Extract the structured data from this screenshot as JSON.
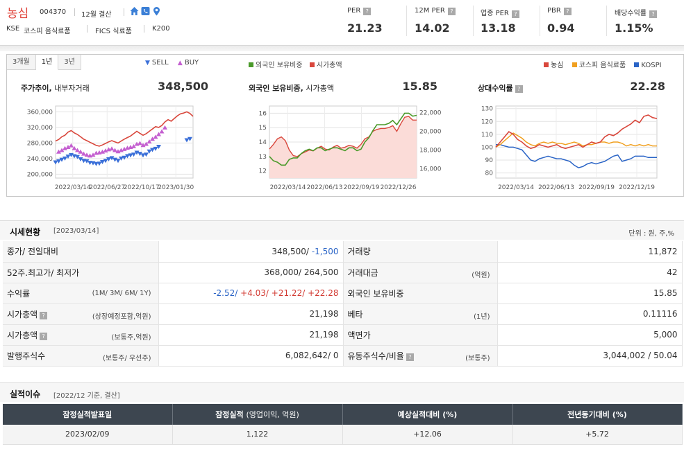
{
  "header": {
    "name": "농심",
    "code": "004370",
    "fiscal": "12월 결산",
    "market": [
      "KSE",
      "코스피 음식료품",
      "FICS 식료품",
      "K200"
    ],
    "metrics": [
      {
        "label": "PER",
        "value": "21.23"
      },
      {
        "label": "12M PER",
        "value": "14.02"
      },
      {
        "label": "업종 PER",
        "value": "13.18"
      },
      {
        "label": "PBR",
        "value": "0.94"
      },
      {
        "label": "배당수익률",
        "value": "1.15%"
      }
    ],
    "icons": [
      "home-icon",
      "phone-icon",
      "location-pin-icon"
    ]
  },
  "charts": {
    "tabs": [
      "3개월",
      "1년",
      "3년"
    ],
    "active_tab": "1년",
    "legend_trade": [
      "SELL",
      "BUY"
    ],
    "legend_foreign": [
      "외국인 보유비중",
      "시가총액"
    ],
    "legend_return": [
      "농심",
      "코스피 음식료품",
      "KOSPI"
    ],
    "colors": {
      "sell": "#3a6fd8",
      "buy": "#c45fd0",
      "price": "#d9473c",
      "foreign": "#4a9a2a",
      "food": "#f0a020",
      "kospi": "#2a64c6"
    },
    "price": {
      "title": "주가추이,",
      "subtitle": "내부자거래",
      "value": "348,500"
    },
    "foreign": {
      "title": "외국인 보유비중,",
      "subtitle": "시가총액",
      "value": "15.85"
    },
    "return": {
      "title": "상대수익률",
      "value": "22.28"
    }
  },
  "chart_data": [
    {
      "type": "line",
      "title": "주가추이",
      "x_ticks": [
        "2022/03/14",
        "2022/06/27",
        "2022/10/17",
        "2023/01/30"
      ],
      "y_ticks": [
        "360,000",
        "320,000",
        "280,000",
        "240,000",
        "200,000"
      ],
      "ylim": [
        190000,
        375000
      ],
      "series": [
        {
          "name": "농심",
          "values": [
            285000,
            289000,
            296000,
            300000,
            308000,
            312000,
            306000,
            302000,
            296000,
            290000,
            286000,
            282000,
            278000,
            274000,
            272000,
            275000,
            279000,
            283000,
            286000,
            283000,
            280000,
            285000,
            290000,
            294000,
            298000,
            304000,
            310000,
            305000,
            300000,
            304000,
            310000,
            316000,
            322000,
            320000,
            325000,
            334000,
            340000,
            336000,
            343000,
            350000,
            355000,
            357000,
            360000,
            356000,
            348500
          ]
        },
        {
          "name": "SELL",
          "values": [
            230000,
            233000,
            237000,
            240000,
            245000,
            249000,
            246000,
            244000,
            238000,
            234000,
            233000,
            229000,
            228000,
            226000,
            227000,
            231000,
            234000,
            238000,
            241000,
            237000,
            234000,
            240000,
            242000,
            246000,
            248000,
            250000,
            255000,
            252000,
            248000,
            250000,
            258000,
            262000,
            265000,
            270000,
            null,
            null,
            null,
            null,
            null,
            null,
            null,
            null,
            287000,
            290000,
            null
          ]
        },
        {
          "name": "BUY",
          "values": [
            null,
            258000,
            262000,
            267000,
            270000,
            274000,
            267000,
            262000,
            258000,
            253000,
            250000,
            248000,
            250000,
            255000,
            256000,
            258000,
            261000,
            264000,
            266000,
            262000,
            259000,
            262000,
            265000,
            268000,
            270000,
            272000,
            278000,
            280000,
            275000,
            278000,
            284000,
            291000,
            296000,
            303000,
            310000,
            320000,
            null,
            null,
            null,
            null,
            null,
            null,
            null,
            null,
            null
          ]
        }
      ]
    },
    {
      "type": "area",
      "title": "외국인 보유비중",
      "x_ticks": [
        "2022/03/14",
        "2022/06/13",
        "2022/09/19",
        "2022/12/26"
      ],
      "y_left_ticks": [
        "16",
        "15",
        "14",
        "13",
        "12"
      ],
      "y_right_ticks": [
        "22,000",
        "20,000",
        "18,000",
        "16,000"
      ],
      "ylim_left": [
        11.5,
        16.5
      ],
      "ylim_right": [
        15000,
        22700
      ],
      "series": [
        {
          "name": "외국인 보유비중",
          "values": [
            13.0,
            12.7,
            12.6,
            12.4,
            12.4,
            12.8,
            12.9,
            12.9,
            13.2,
            13.4,
            13.5,
            13.4,
            13.6,
            13.6,
            13.4,
            13.5,
            13.6,
            13.6,
            13.5,
            13.4,
            13.6,
            13.6,
            13.4,
            13.5,
            14.0,
            14.3,
            14.8,
            15.2,
            15.2,
            15.2,
            15.3,
            15.5,
            15.2,
            15.6,
            16.0,
            16.0,
            15.8,
            15.85
          ]
        },
        {
          "name": "시가총액",
          "values": [
            18100,
            18600,
            19200,
            19400,
            19000,
            18000,
            17400,
            17300,
            17600,
            17800,
            18000,
            17900,
            18200,
            18400,
            18100,
            18000,
            18300,
            18500,
            18200,
            18300,
            18500,
            18400,
            18200,
            18600,
            19200,
            19400,
            20000,
            20200,
            20300,
            20300,
            20400,
            20600,
            20000,
            20800,
            21500,
            21600,
            21200,
            21198
          ]
        }
      ]
    },
    {
      "type": "line",
      "title": "상대수익률",
      "x_ticks": [
        "2022/03/14",
        "2022/06/13",
        "2022/09/19",
        "2022/12/19"
      ],
      "y_ticks": [
        "130",
        "120",
        "110",
        "100",
        "90",
        "80"
      ],
      "ylim": [
        76,
        132
      ],
      "series": [
        {
          "name": "농심",
          "values": [
            100,
            104,
            108,
            112,
            110,
            106,
            104,
            101,
            99,
            100,
            102,
            101,
            100,
            101,
            102,
            100,
            99,
            100,
            101,
            102,
            100,
            102,
            104,
            103,
            104,
            108,
            110,
            109,
            111,
            114,
            116,
            118,
            121,
            119,
            124,
            125,
            123,
            122.28
          ]
        },
        {
          "name": "코스피 음식료품",
          "values": [
            100,
            102,
            105,
            108,
            111,
            109,
            107,
            104,
            102,
            101,
            103,
            104,
            103,
            104,
            103,
            103,
            102,
            103,
            104,
            103,
            101,
            102,
            102,
            103,
            104,
            104,
            103,
            104,
            104,
            103,
            101,
            102,
            101,
            102,
            101,
            102,
            101,
            101
          ]
        },
        {
          "name": "KOSPI",
          "values": [
            102,
            102,
            101,
            100,
            100,
            99,
            98,
            94,
            90,
            89,
            91,
            92,
            93,
            92,
            91,
            91,
            90,
            89,
            86,
            84,
            85,
            87,
            88,
            87,
            88,
            89,
            91,
            93,
            94,
            89,
            90,
            91,
            93,
            93,
            93,
            92,
            92,
            92
          ]
        }
      ]
    }
  ],
  "market": {
    "title": "시세현황",
    "date": "[2023/03/14]",
    "unit": "단위 : 원, 주,%",
    "rows": [
      {
        "l1": "종가/ 전일대비",
        "s1": "",
        "v1a": "348,500/",
        "v1b": "-1,500",
        "l2": "거래량",
        "s2": "",
        "v2": "11,872"
      },
      {
        "l1": "52주.최고가/ 최저가",
        "s1": "",
        "v1a": "368,000/ 264,500",
        "v1b": "",
        "l2": "거래대금",
        "s2": "(억원)",
        "v2": "42"
      },
      {
        "l1": "수익률",
        "s1": "(1M/ 3M/ 6M/ 1Y)",
        "ret": [
          "-2.52/",
          "+4.03/",
          "+21.22/",
          "+22.28"
        ],
        "l2": "외국인 보유비중",
        "s2": "",
        "v2": "15.85"
      },
      {
        "l1": "시가총액",
        "s1": "(상장예정포함,억원)",
        "v1a": "21,198",
        "v1b": "",
        "l2": "베타",
        "s2": "(1년)",
        "v2": "0.11116"
      },
      {
        "l1": "시가총액",
        "s1": "(보통주,억원)",
        "v1a": "21,198",
        "v1b": "",
        "l2": "액면가",
        "s2": "",
        "v2": "5,000"
      },
      {
        "l1": "발행주식수",
        "s1": "(보통주/ 우선주)",
        "v1a": "6,082,642/ 0",
        "v1b": "",
        "l2": "유동주식수/비율",
        "s2": "(보통주)",
        "v2": "3,044,002 / 50.04"
      }
    ]
  },
  "perf": {
    "title": "실적이슈",
    "basis": "[2022/12 기준, 결산]",
    "headers": [
      "잠정실적발표일",
      "잠정실적",
      "(영업이익, 억원)",
      "예상실적대비 (%)",
      "전년동기대비 (%)"
    ],
    "row": [
      "2023/02/09",
      "1,122",
      "+12.06",
      "+5.72"
    ]
  }
}
